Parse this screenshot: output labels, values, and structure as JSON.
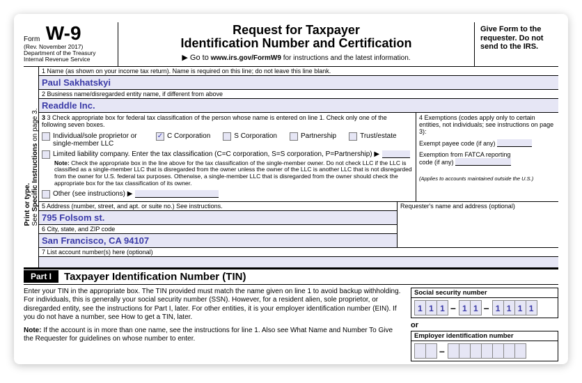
{
  "header": {
    "formWord": "Form",
    "formNumber": "W-9",
    "rev": "(Rev. November 2017)",
    "dept1": "Department of the Treasury",
    "dept2": "Internal Revenue Service",
    "title1": "Request for Taxpayer",
    "title2": "Identification Number and Certification",
    "gotoPrefix": "▶ Go to",
    "gotoUrl": "www.irs.gov/FormW9",
    "gotoSuffix": "for instructions and the latest information.",
    "rightNote": "Give Form to the requester. Do not send to the IRS."
  },
  "sideLabel": {
    "a": "Print or type.",
    "b": "See ",
    "c": "Specific Instructions",
    "d": " on page 3."
  },
  "line1": {
    "label": "1  Name (as shown on your income tax return). Name is required on this line; do not leave this line blank.",
    "value": "Paul Sakhatskyi"
  },
  "line2": {
    "label": "2  Business name/disregarded entity name, if different from above",
    "value": "Readdle Inc."
  },
  "line3": {
    "label": "3  Check appropriate box for federal tax classification of the person whose name is entered on line 1. Check only one of the following seven boxes.",
    "opts": {
      "individual": "Individual/sole proprietor or single-member LLC",
      "ccorp": "C Corporation",
      "scorp": "S Corporation",
      "partnership": "Partnership",
      "trust": "Trust/estate",
      "llc": "Limited liability company. Enter the tax classification (C=C corporation, S=S corporation, P=Partnership) ▶",
      "other": "Other (see instructions) ▶"
    },
    "checked": "ccorp",
    "noteBold": "Note:",
    "noteText": " Check the appropriate box in the line above for the tax classification of the single-member owner.  Do not check LLC if the LLC is classified as a single-member LLC that is disregarded from the owner unless the owner of the LLC is another LLC that is not disregarded from the owner for U.S. federal tax purposes. Otherwise, a single-member LLC that is disregarded from the owner should check the appropriate box for the tax classification of its owner."
  },
  "line4": {
    "label": "4  Exemptions (codes apply only to certain entities, not individuals; see instructions on page 3):",
    "exemptPayee": "Exempt payee code (if any)",
    "fatca1": "Exemption from FATCA reporting",
    "fatca2": "code (if any)",
    "applies": "(Applies to accounts maintained outside the U.S.)"
  },
  "line5": {
    "label": "5  Address (number, street, and apt. or suite no.) See instructions.",
    "value": "795 Folsom st."
  },
  "requester": "Requester's name and address (optional)",
  "line6": {
    "label": "6  City, state, and ZIP code",
    "value": "San Francisco, CA 94107"
  },
  "line7": {
    "label": "7  List account number(s) here (optional)"
  },
  "part1": {
    "label": "Part I",
    "title": "Taxpayer Identification Number (TIN)"
  },
  "tin": {
    "p1": "Enter your TIN in the appropriate box. The TIN provided must match the name given on line 1 to avoid backup withholding. For individuals, this is generally your social security number (SSN). However, for a resident alien, sole proprietor, or disregarded entity, see the instructions for Part I, later. For other entities, it is your employer identification number (EIN). If you do not have a number, see How to get a TIN, later.",
    "noteBold": "Note:",
    "noteText": " If the account is in more than one name, see the instructions for line 1. Also see What Name and Number To Give the Requester for guidelines on whose number to enter.",
    "ssnLabel": "Social security number",
    "or": "or",
    "einLabel": "Employer identification number",
    "ssn": [
      "1",
      "1",
      "1",
      "1",
      "1",
      "1",
      "1",
      "1",
      "1"
    ]
  }
}
